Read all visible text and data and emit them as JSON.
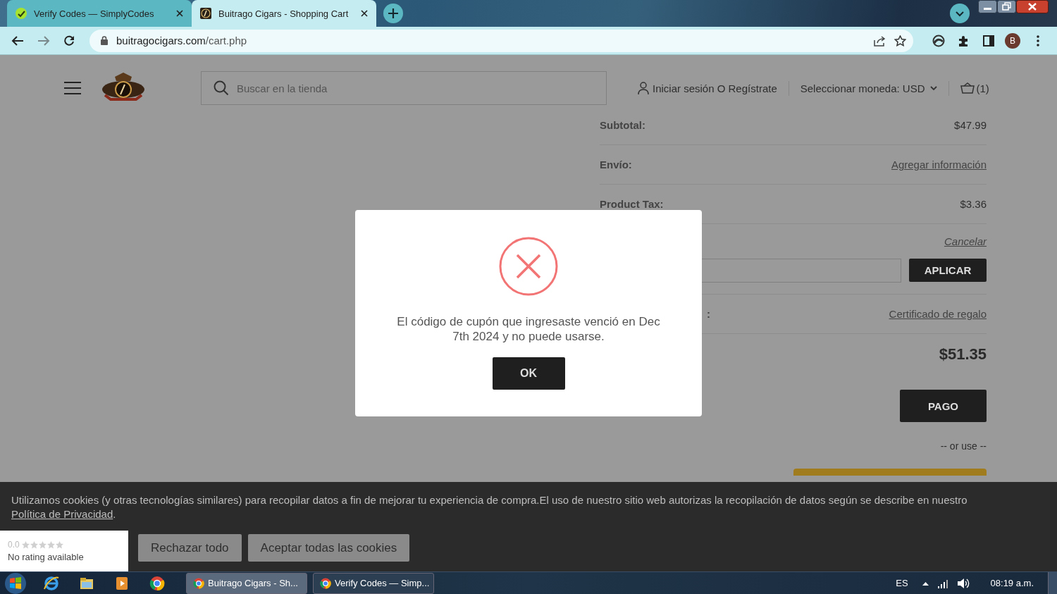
{
  "browser": {
    "tabs": [
      {
        "title": "Verify Codes — SimplyCodes",
        "selected": false
      },
      {
        "title": "Buitrago Cigars - Shopping Cart",
        "selected": true
      }
    ],
    "address": {
      "domain": "buitragocigars.com",
      "path": "/cart.php"
    },
    "profile_initial": "B"
  },
  "header": {
    "search_placeholder": "Buscar en la tienda",
    "account_link": "Iniciar sesión O Regístrate",
    "currency": "Seleccionar moneda: USD",
    "cart_count": "(1)"
  },
  "summary": {
    "rows": [
      {
        "kind": "value",
        "label": "Subtotal:",
        "value": "$47.99"
      },
      {
        "kind": "link",
        "label": "Envío:",
        "value": "Agregar información"
      },
      {
        "kind": "value",
        "label": "Product Tax:",
        "value": "$3.36"
      }
    ],
    "coupon": {
      "cancel": "Cancelar",
      "apply": "APLICAR"
    },
    "gift": {
      "label": ":",
      "link": "Certificado de regalo"
    },
    "total": "$51.35",
    "checkout": "PAGO",
    "alt": "-- or use --"
  },
  "dialog": {
    "message": "El código de cupón que ingresaste venció en Dec 7th 2024 y no puede usarse.",
    "button": "OK"
  },
  "cookie_banner": {
    "text": "Utilizamos cookies (y otras tecnologías similares) para recopilar datos a fin de mejorar tu experiencia de compra.El uso de nuestro sitio web autorizas la recopilación de datos según se describe en nuestro",
    "link": "Política de Privacidad",
    "after": ".",
    "buttons": [
      "Rechazar todo",
      "Aceptar todas las cookies"
    ]
  },
  "rating_widget": {
    "score": "0.0",
    "stars": 0,
    "note": "No rating available"
  },
  "taskbar": {
    "windows": [
      {
        "title": "Buitrago Cigars - Sh...",
        "selected": true
      },
      {
        "title": "Verify Codes — Simp...",
        "selected": false
      }
    ],
    "language": "ES",
    "clock": "08:19 a.m."
  }
}
